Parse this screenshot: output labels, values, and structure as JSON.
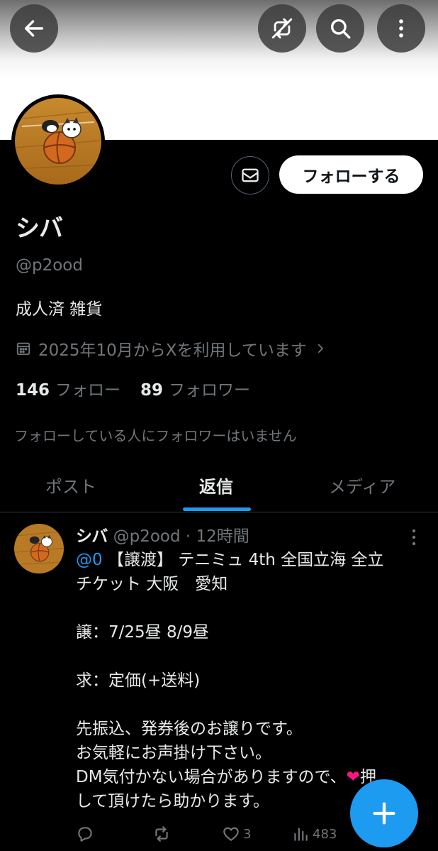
{
  "header": {
    "back_icon": "arrow-left-icon",
    "no_retweets_icon": "retweet-off-icon",
    "search_icon": "search-icon",
    "more_icon": "more-vertical-icon"
  },
  "profile": {
    "display_name": "シバ",
    "handle": "@p2ood",
    "bio": "成人済 雑貨",
    "joined": "2025年10月からXを利用しています",
    "following_count": "146",
    "following_label": "フォロー",
    "followers_count": "89",
    "followers_label": "フォロワー",
    "mutual_note": "フォローしている人にフォロワーはいません",
    "follow_button": "フォローする"
  },
  "tabs": [
    {
      "label": "ポスト",
      "active": false
    },
    {
      "label": "返信",
      "active": true
    },
    {
      "label": "メディア",
      "active": false
    }
  ],
  "post": {
    "name": "シバ",
    "meta": "@p2ood · 12時間",
    "mention": "@0",
    "line1_rest": " 【譲渡】 テニミュ 4th 全国立海 全立",
    "line2": "チケット 大阪　愛知",
    "line3": "譲：7/25昼 8/9昼",
    "line4": "求：定価(+送料)",
    "line5": "先振込、発券後のお譲りです。",
    "line6": "お気軽にお声掛け下さい。",
    "line7_pre": "DM気付かない場合がありますので、",
    "line7_post": "押",
    "line8": "して頂けたら助かります。",
    "likes": "3",
    "views": "483"
  },
  "colors": {
    "accent": "#1d9bf0",
    "background": "#000000",
    "secondary_text": "#71767b",
    "heart": "#f91880"
  }
}
